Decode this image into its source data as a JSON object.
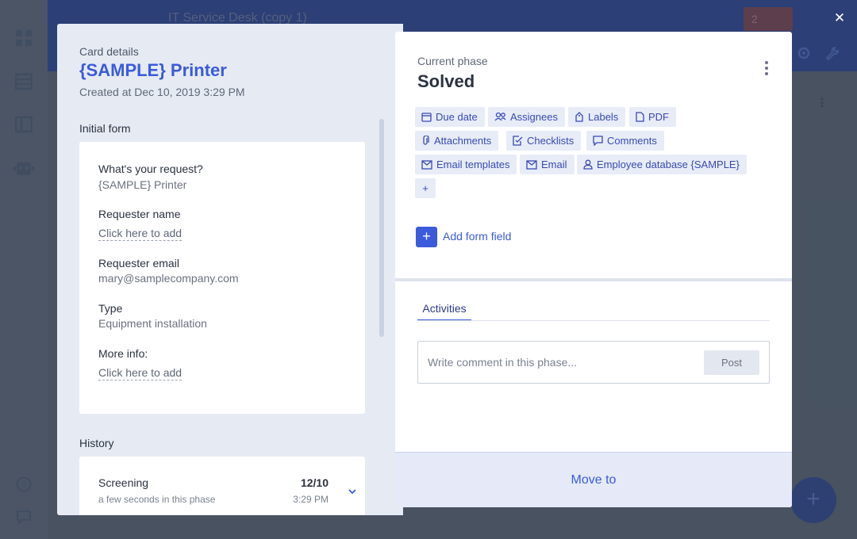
{
  "background": {
    "app_title": "IT Service Desk (copy 1)",
    "notification_count": "2",
    "fab_label": "+",
    "sidebar_icons": [
      "dashboard-icon",
      "database-icon",
      "reports-icon",
      "bot-icon",
      "help-icon",
      "chat-icon"
    ]
  },
  "modal": {
    "close_label": "✕",
    "card": {
      "kicker": "Card details",
      "title": "{SAMPLE} Printer",
      "created": "Created at Dec 10, 2019 3:29 PM"
    },
    "initial_form": {
      "title": "Initial form",
      "fields": [
        {
          "label": "What's your request?",
          "value": "{SAMPLE} Printer"
        },
        {
          "label": "Requester name",
          "link": "Click here to add"
        },
        {
          "label": "Requester email",
          "value": "mary@samplecompany.com"
        },
        {
          "label": "Type",
          "value": "Equipment installation"
        },
        {
          "label": "More info:",
          "link": "Click here to add"
        }
      ]
    },
    "history": {
      "title": "History",
      "items": [
        {
          "phase": "Screening",
          "duration": "a few seconds in this phase",
          "date": "12/10",
          "time": "3:29 PM"
        }
      ]
    },
    "current_phase": {
      "kicker": "Current phase",
      "name": "Solved"
    },
    "chips": [
      {
        "label": "Due date",
        "icon": "calendar-icon"
      },
      {
        "label": "Assignees",
        "icon": "users-icon"
      },
      {
        "label": "Labels",
        "icon": "tag-icon"
      },
      {
        "label": "PDF",
        "icon": "file-icon"
      },
      {
        "label": "Attachments",
        "icon": "paperclip-icon"
      },
      {
        "label": "Checklists",
        "icon": "checklist-icon"
      },
      {
        "label": "Comments",
        "icon": "comment-icon"
      },
      {
        "label": "Email templates",
        "icon": "envelope-icon"
      },
      {
        "label": "Email",
        "icon": "envelope-icon"
      },
      {
        "label": "Employee database {SAMPLE}",
        "icon": "person-icon"
      },
      {
        "label": "+",
        "icon": ""
      }
    ],
    "add_form_field": "Add form field",
    "activities": {
      "tab": "Activities",
      "comment_placeholder": "Write comment in this phase...",
      "post_label": "Post"
    },
    "move_to": "Move to"
  },
  "colors": {
    "accent": "#3b5bdb",
    "header": "#233f96",
    "chip_bg": "#e7ecf7",
    "panel_bg": "#e6ebf3"
  }
}
